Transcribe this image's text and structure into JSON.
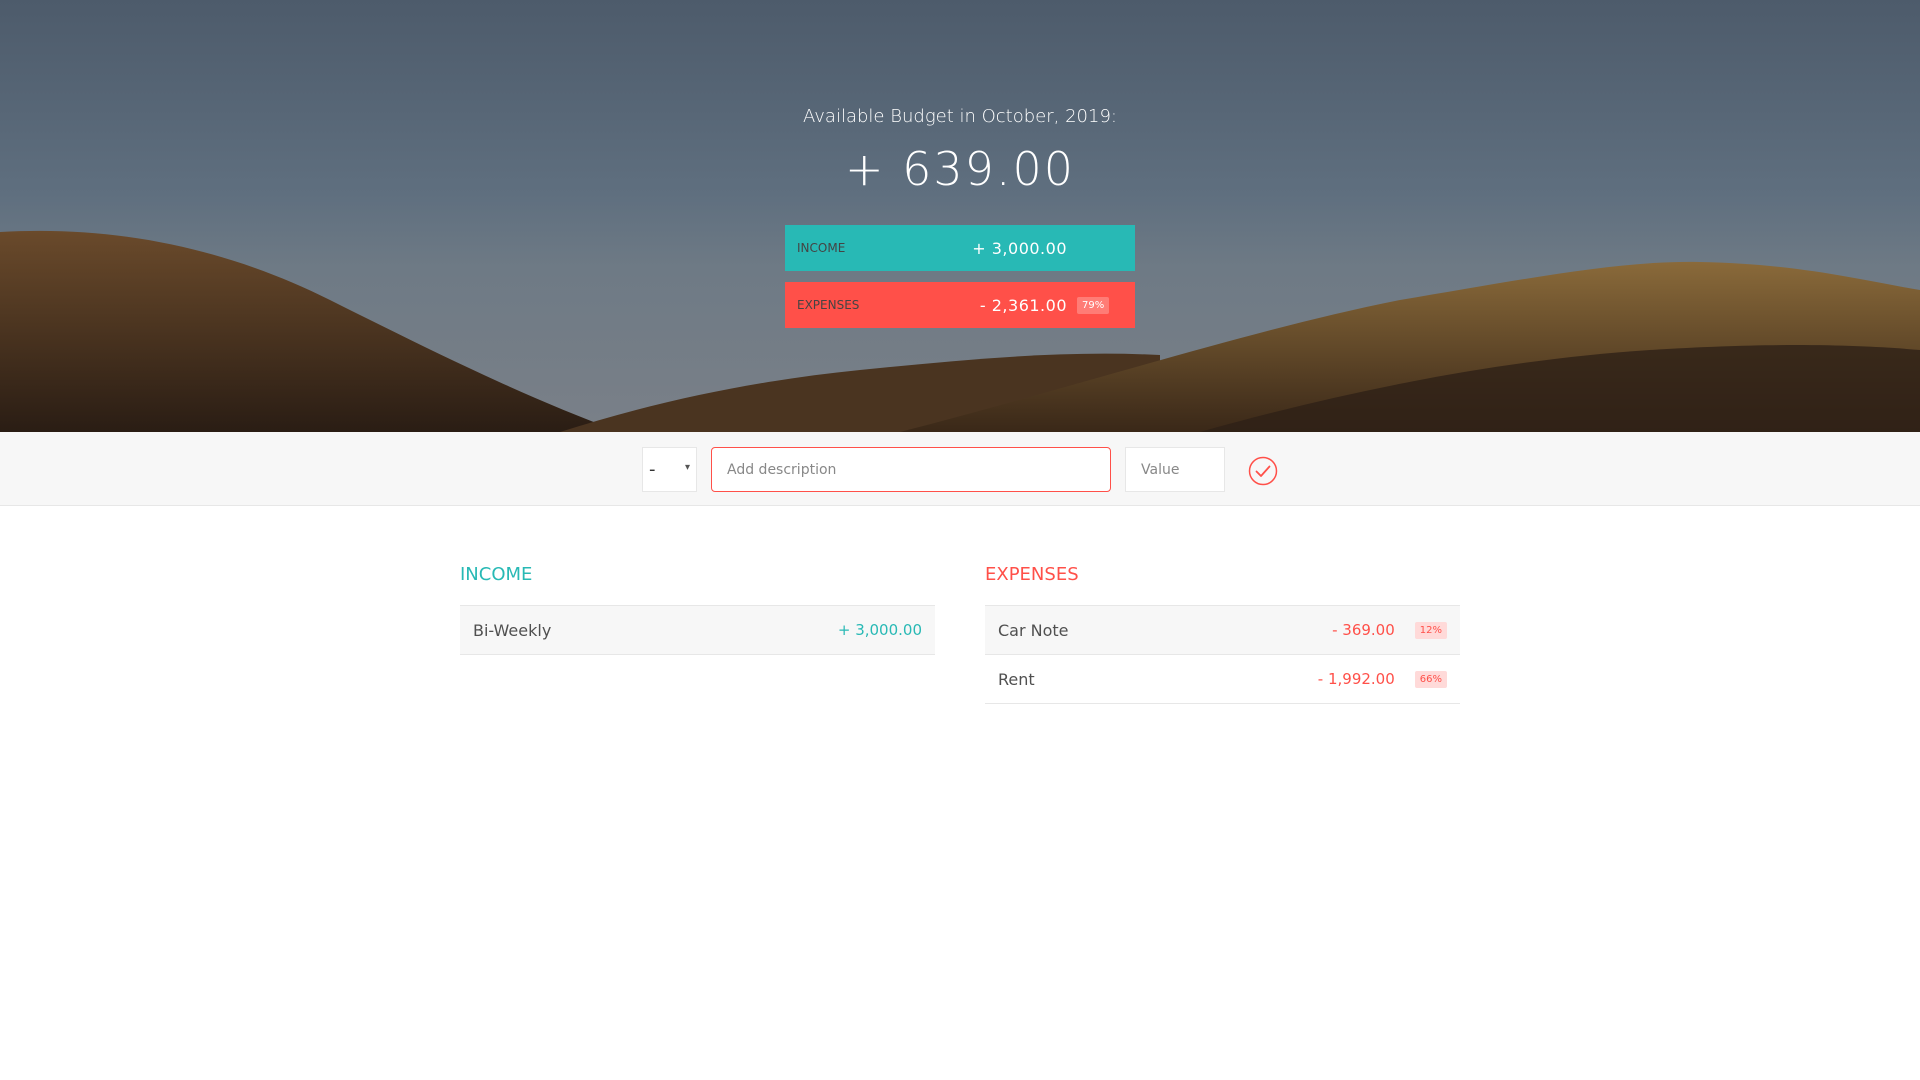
{
  "colors": {
    "income": "#28b9b5",
    "expenses": "#ff5049",
    "sky": "#5a6878",
    "hills": "#3d2c1f"
  },
  "budget": {
    "title": "Available Budget in October, 2019:",
    "value": "+ 639.00",
    "income": {
      "label": "Income",
      "value": "+ 3,000.00"
    },
    "expenses": {
      "label": "Expenses",
      "value": "- 2,361.00",
      "percentage": "79%"
    }
  },
  "add": {
    "type_value": "-",
    "type_caret": "▾",
    "description_placeholder": "Add description",
    "value_placeholder": "Value",
    "submit_icon": "checkmark-circle-icon"
  },
  "income": {
    "title": "Income",
    "items": [
      {
        "description": "Bi-Weekly",
        "value": "+ 3,000.00"
      }
    ]
  },
  "expenses": {
    "title": "Expenses",
    "items": [
      {
        "description": "Car Note",
        "value": "- 369.00",
        "percentage": "12%"
      },
      {
        "description": "Rent",
        "value": "- 1,992.00",
        "percentage": "66%"
      }
    ]
  }
}
